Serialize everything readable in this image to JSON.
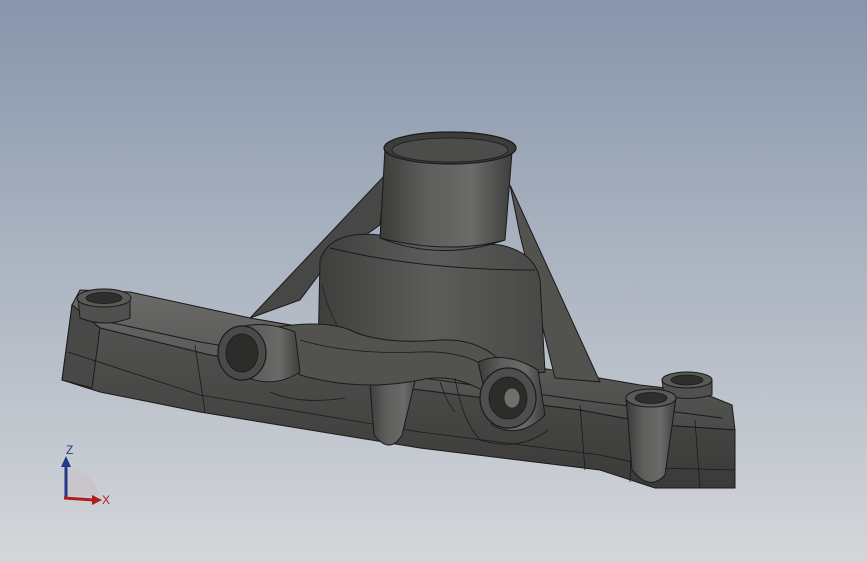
{
  "viewport": {
    "background_top": "#8795ab",
    "background_bottom": "#d4d6da"
  },
  "model": {
    "body_color": "#5a5a58",
    "edge_color": "#1a1a1a"
  },
  "triad": {
    "z_label": "Z",
    "x_label": "X",
    "z_color": "#1f3a8a",
    "x_color": "#b01e1e"
  }
}
